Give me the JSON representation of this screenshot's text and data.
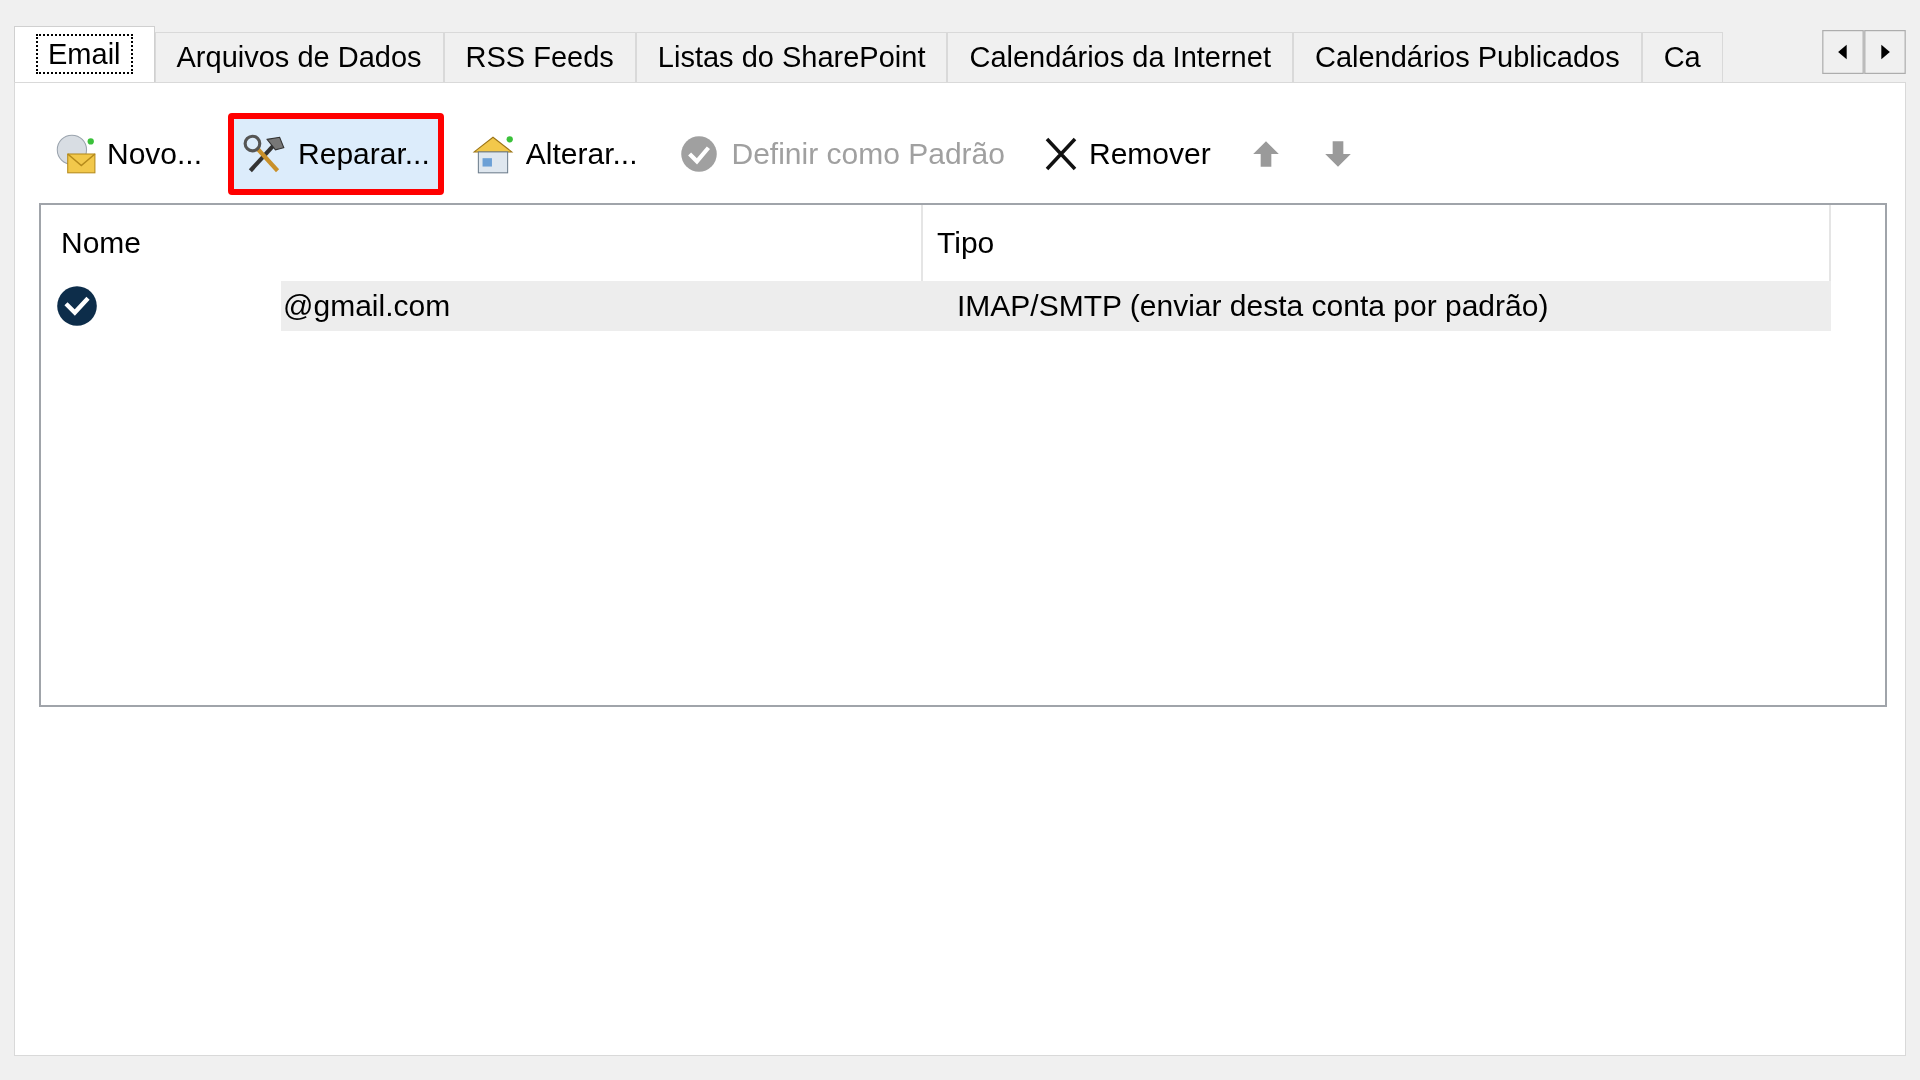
{
  "tabs": [
    {
      "label": "Email",
      "selected": true
    },
    {
      "label": "Arquivos de Dados",
      "selected": false
    },
    {
      "label": "RSS Feeds",
      "selected": false
    },
    {
      "label": "Listas do SharePoint",
      "selected": false
    },
    {
      "label": "Calendários da Internet",
      "selected": false
    },
    {
      "label": "Calendários Publicados",
      "selected": false
    },
    {
      "label": "Ca",
      "selected": false
    }
  ],
  "toolbar": [
    {
      "kind": "new",
      "label": "Novo...",
      "disabled": false,
      "highlighted": false
    },
    {
      "kind": "repair",
      "label": "Reparar...",
      "disabled": false,
      "highlighted": true
    },
    {
      "kind": "change",
      "label": "Alterar...",
      "disabled": false,
      "highlighted": false
    },
    {
      "kind": "default",
      "label": "Definir como Padrão",
      "disabled": true,
      "highlighted": false
    },
    {
      "kind": "remove",
      "label": "Remover",
      "disabled": false,
      "highlighted": false
    },
    {
      "kind": "up",
      "disabled": true,
      "highlighted": false
    },
    {
      "kind": "down",
      "disabled": true,
      "highlighted": false
    }
  ],
  "table": {
    "columns": [
      "Nome",
      "Tipo"
    ],
    "rows": [
      {
        "name": "@gmail.com",
        "type": "IMAP/SMTP (enviar desta conta por padrão)",
        "selected": true
      }
    ]
  }
}
